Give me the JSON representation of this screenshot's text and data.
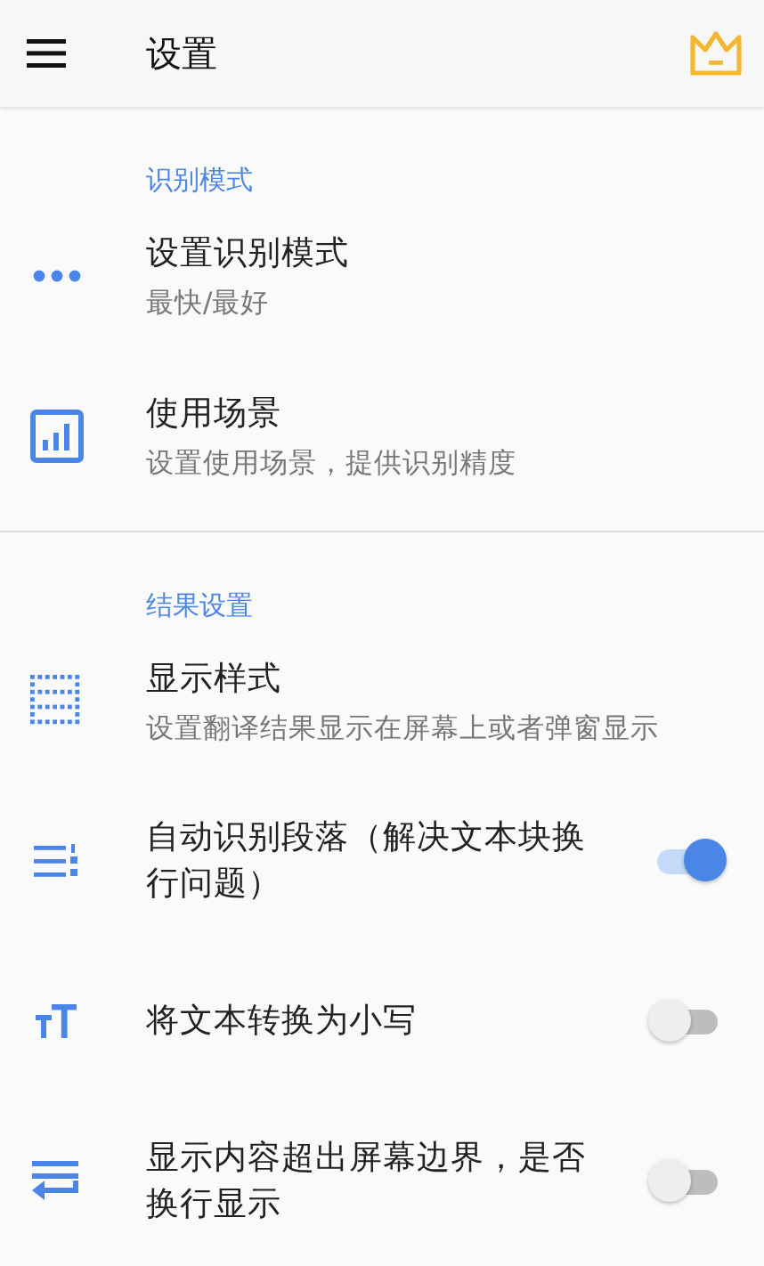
{
  "app_bar": {
    "title": "设置"
  },
  "sections": [
    {
      "header": "识别模式",
      "items": [
        {
          "kind": "nav",
          "title": "设置识别模式",
          "subtitle": "最快/最好"
        },
        {
          "kind": "nav",
          "title": "使用场景",
          "subtitle": "设置使用场景，提供识别精度"
        }
      ]
    },
    {
      "header": "结果设置",
      "items": [
        {
          "kind": "nav",
          "title": "显示样式",
          "subtitle": "设置翻译结果显示在屏幕上或者弹窗显示"
        },
        {
          "kind": "toggle",
          "title": "自动识别段落（解决文本块换行问题）",
          "on": true
        },
        {
          "kind": "toggle",
          "title": "将文本转换为小写",
          "on": false
        },
        {
          "kind": "toggle",
          "title": "显示内容超出屏幕边界，是否换行显示",
          "on": false
        }
      ]
    }
  ]
}
